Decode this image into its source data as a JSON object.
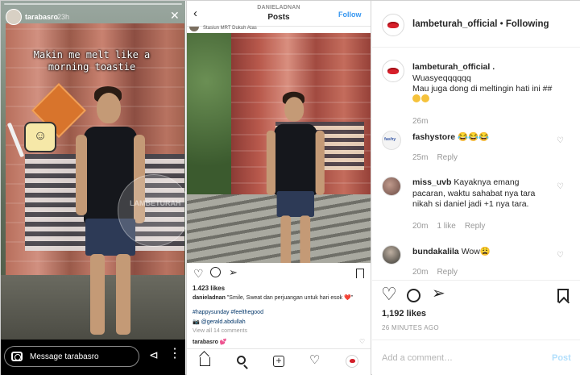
{
  "story": {
    "username": "tarabasro",
    "time": "23h",
    "close": "✕",
    "caption": "Makin me melt like a morning toastie",
    "watermark": "LAMBETURAH",
    "message_placeholder": "Message tarabasro",
    "dm_glyph": "⊲",
    "more_glyph": "⋮"
  },
  "post": {
    "owner_username": "DANIELADNAN",
    "title": "Posts",
    "follow_label": "Follow",
    "location": "Stasiun MRT Dukuh Atas",
    "likes": "1.423 likes",
    "caption_user": "danieladnan",
    "caption_text": "\"Smile, Sweat dan perjuangan untuk hari esok ❤️\"",
    "hashtags": "#happysunday #feelthegood",
    "credit_icon": "📷",
    "credit": "@gerald.abdullah",
    "view_all": "View all 14 comments",
    "first_comment": "tarabasro 💕"
  },
  "desktop": {
    "account": "lambeturah_official",
    "separator": " • ",
    "following": "Following",
    "caption_user": "lambeturah_official .",
    "caption_text": "Wuasyeqqqqqq\nMau juga dong di meltingin hati ini ##",
    "caption_time": "26m",
    "comments": [
      {
        "user": "fashystore",
        "text": "😂😂😂",
        "time": "25m",
        "likes": "",
        "reply": "Reply"
      },
      {
        "user": "miss_uvb",
        "text": "Kayaknya emang pacaran, waktu sahabat nya tara nikah si daniel jadi +1 nya tara.",
        "time": "20m",
        "likes": "1 like",
        "reply": "Reply"
      },
      {
        "user": "bundakalila",
        "text": "Wow😩",
        "time": "20m",
        "likes": "",
        "reply": "Reply"
      }
    ],
    "likes": "1,192 likes",
    "ago": "26 MINUTES AGO",
    "add_comment_placeholder": "Add a comment…",
    "post_label": "Post"
  },
  "icons": {
    "back": "‹",
    "heart": "♡",
    "share": "➢"
  }
}
